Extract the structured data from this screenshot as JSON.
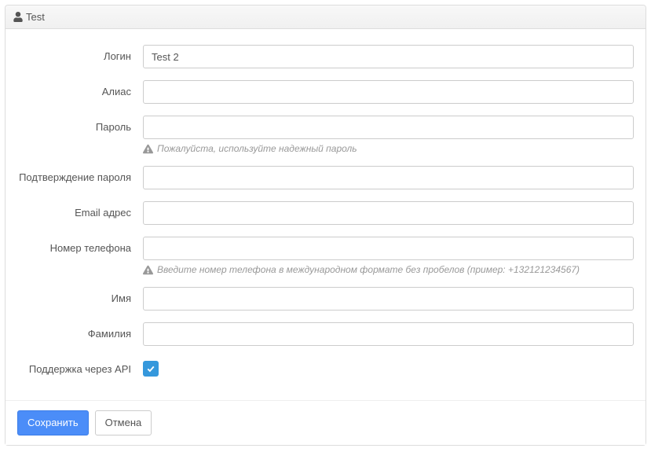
{
  "panel": {
    "title": "Test"
  },
  "form": {
    "login": {
      "label": "Логин",
      "value": "Test 2"
    },
    "alias": {
      "label": "Алиас",
      "value": ""
    },
    "password": {
      "label": "Пароль",
      "value": "",
      "help": "Пожалуйста, используйте надежный пароль"
    },
    "password_confirm": {
      "label": "Подтверждение пароля",
      "value": ""
    },
    "email": {
      "label": "Email адрес",
      "value": ""
    },
    "phone": {
      "label": "Номер телефона",
      "value": "",
      "help": "Введите номер телефона в международном формате без пробелов (пример: +132121234567)"
    },
    "firstname": {
      "label": "Имя",
      "value": ""
    },
    "lastname": {
      "label": "Фамилия",
      "value": ""
    },
    "api_support": {
      "label": "Поддержка через API",
      "checked": true
    }
  },
  "buttons": {
    "save": "Сохранить",
    "cancel": "Отмена"
  }
}
